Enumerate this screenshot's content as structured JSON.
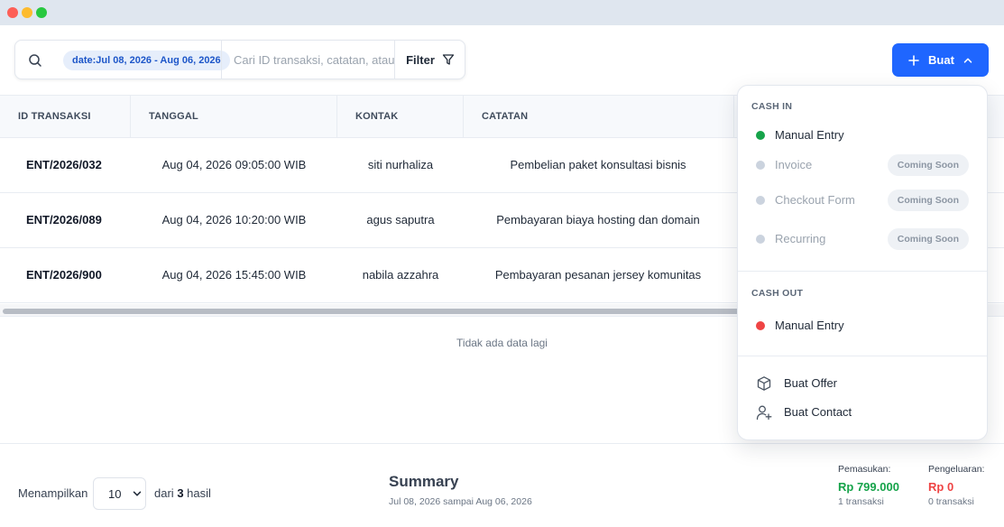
{
  "toolbar": {
    "date_chip": "date:Jul 08, 2026 - Aug 06, 2026",
    "search_placeholder": "Cari ID transaksi, catatan, atau kontak",
    "filter_label": "Filter",
    "create_label": "Buat"
  },
  "table": {
    "columns": [
      "ID TRANSAKSI",
      "TANGGAL",
      "KONTAK",
      "CATATAN"
    ],
    "rows": [
      {
        "id": "ENT/2026/032",
        "date": "Aug 04, 2026 09:05:00 WIB",
        "contact": "siti nurhaliza",
        "note": "Pembelian paket konsultasi bisnis"
      },
      {
        "id": "ENT/2026/089",
        "date": "Aug 04, 2026 10:20:00 WIB",
        "contact": "agus saputra",
        "note": "Pembayaran biaya hosting dan domain"
      },
      {
        "id": "ENT/2026/900",
        "date": "Aug 04, 2026 15:45:00 WIB",
        "contact": "nabila azzahra",
        "note": "Pembayaran pesanan jersey komunitas"
      }
    ],
    "empty_text": "Tidak ada data lagi"
  },
  "footer": {
    "showing_label": "Menampilkan",
    "page_size": "10",
    "result_prefix": "dari",
    "result_count": "3",
    "result_suffix": "hasil",
    "summary_title": "Summary",
    "summary_range": "Jul 08, 2026 sampai Aug 06, 2026",
    "income_label": "Pemasukan:",
    "income_value": "Rp 799.000",
    "income_count": "1 transaksi",
    "expense_label": "Pengeluaran:",
    "expense_value": "Rp 0",
    "expense_count": "0 transaksi"
  },
  "dropdown": {
    "cash_in_label": "CASH IN",
    "cash_in_items": [
      {
        "label": "Manual Entry",
        "badge": ""
      },
      {
        "label": "Invoice",
        "badge": "Coming Soon"
      },
      {
        "label": "Checkout Form",
        "badge": "Coming Soon"
      },
      {
        "label": "Recurring",
        "badge": "Coming Soon"
      }
    ],
    "cash_out_label": "CASH OUT",
    "cash_out_items": [
      {
        "label": "Manual Entry"
      }
    ],
    "extra_items": [
      {
        "label": "Buat Offer",
        "icon": "box-icon"
      },
      {
        "label": "Buat Contact",
        "icon": "user-add-icon"
      }
    ]
  },
  "colors": {
    "primary": "#1f66ff",
    "cash_in_dot": "#16a34a",
    "cash_out_dot": "#ef4444",
    "disabled_dot": "#cbd3de",
    "income_value": "#16a34a",
    "expense_value": "#ef4444"
  }
}
